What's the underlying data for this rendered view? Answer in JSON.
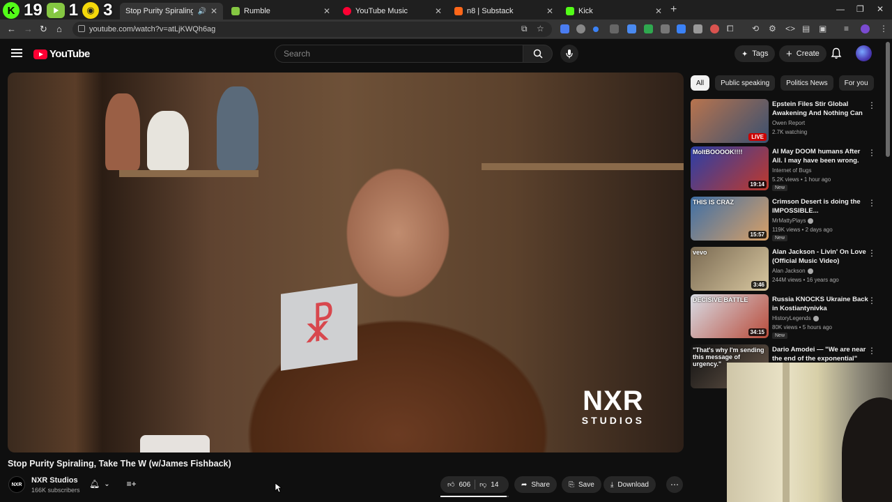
{
  "overlay": {
    "k_count": "19",
    "r_count": "1",
    "y_count": "3"
  },
  "tabs": [
    {
      "title": "Stop Purity Spiraling, Take T",
      "favicon_color": "#ff0033",
      "active": true
    },
    {
      "title": "Rumble",
      "favicon_color": "#85c742",
      "active": false
    },
    {
      "title": "YouTube Music",
      "favicon_color": "#ff0033",
      "active": false
    },
    {
      "title": "n8 | Substack",
      "favicon_color": "#ff6719",
      "active": false
    },
    {
      "title": "Kick",
      "favicon_color": "#53fc18",
      "active": false
    }
  ],
  "url": "youtube.com/watch?v=atLjKWQh6ag",
  "header": {
    "logo_text": "YouTube",
    "search_placeholder": "Search",
    "tags_label": "Tags",
    "create_label": "Create"
  },
  "video": {
    "title": "Stop Purity Spiraling, Take The W (w/James Fishback)",
    "watermark_big": "NXR",
    "watermark_small": "STUDIOS",
    "cube_letters": "N R"
  },
  "channel": {
    "name": "NXR Studios",
    "subscribers": "166K subscribers",
    "avatar_text": "NXR"
  },
  "actions": {
    "likes": "606",
    "dislikes": "14",
    "share_label": "Share",
    "save_label": "Save",
    "download_label": "Download",
    "like_ratio": 0.97
  },
  "chips": [
    "All",
    "Public speaking",
    "Politics News",
    "For you"
  ],
  "recommendations": [
    {
      "title": "Epstein Files Stir Global Awakening And Nothing Can ...",
      "channel": "Owen Report",
      "meta": "2.7K watching",
      "badge": "LIVE",
      "verified": false,
      "new": false,
      "thumb_colors": [
        "#b8744e",
        "#3a5070"
      ]
    },
    {
      "title": "AI May DOOM humans After All. I may have been wrong.",
      "channel": "Internet of Bugs",
      "meta": "5.2K views • 1 hour ago",
      "badge": "19:14",
      "verified": false,
      "new": true,
      "thumb_text": "MoltBOOOOK!!!!",
      "thumb_colors": [
        "#2a3fa8",
        "#c0392b"
      ]
    },
    {
      "title": "Crimson Desert is doing the IMPOSSIBLE...",
      "channel": "MrMattyPlays",
      "meta": "119K views • 2 days ago",
      "badge": "15:57",
      "verified": true,
      "new": true,
      "thumb_text": "THIS IS CRAZ",
      "thumb_colors": [
        "#3e6fa6",
        "#d9a066"
      ]
    },
    {
      "title": "Alan Jackson - Livin' On Love (Official Music Video)",
      "channel": "Alan Jackson",
      "meta": "244M views • 16 years ago",
      "badge": "3:46",
      "verified": true,
      "new": false,
      "thumb_text": "vevo",
      "thumb_colors": [
        "#7a6a52",
        "#d8c7a0"
      ]
    },
    {
      "title": "Russia KNOCKS Ukraine Back in Kostiantynivka",
      "channel": "HistoryLegends",
      "meta": "80K views • 5 hours ago",
      "badge": "34:15",
      "verified": true,
      "new": true,
      "thumb_text": "DECISIVE BATTLE",
      "thumb_colors": [
        "#d8dde6",
        "#b84b3a"
      ]
    },
    {
      "title": "Dario Amodei — \"We are near the end of the exponential\"",
      "channel": "",
      "meta": "",
      "badge": "",
      "verified": false,
      "new": false,
      "thumb_text": "\"That's why I'm sending this message of urgency.\"",
      "thumb_colors": [
        "#111111",
        "#6b5a4c"
      ]
    }
  ],
  "new_label": "New"
}
